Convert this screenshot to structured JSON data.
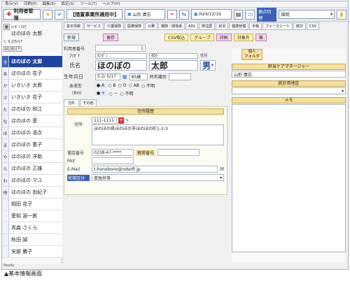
{
  "menu": [
    "表示(V)",
    "印刷(P)",
    "編集(E)",
    "設定(S)",
    "ツール(T)",
    "ヘルプ(H)"
  ],
  "toolbar": {
    "title": "利用者管理",
    "mode": "【措置事業所適用中】",
    "user": "山形 廣志",
    "date": "H24/12/19",
    "office_label": "拠点切替",
    "office_value": "福岡"
  },
  "tabs": [
    "基本情報",
    "サービス",
    "介護保険",
    "医療保険",
    "公費",
    "親族・関係者",
    "ADL",
    "既往歴",
    "状況",
    "健康管理",
    "手帳",
    "フェースシート",
    "統計",
    "CSV"
  ],
  "actions": {
    "new": "新規",
    "save": "保存",
    "csv": "CSV取込",
    "group": "グループ",
    "print": "印刷",
    "target": "対象外",
    "cancel": "無"
  },
  "left": {
    "header_kana": "ﾎﾉﾎﾞﾉ ﾀﾛｳ",
    "header_name": "ほのぼの 太郎",
    "header_date": "S 2/5/17",
    "kana_col": [
      "全",
      "あ",
      "か",
      "さ",
      "た",
      "な",
      "は",
      "ま",
      "や",
      "ら",
      "わ",
      "他"
    ],
    "names": [
      "ほのぼの 太郎",
      "ほのぼの 花子",
      "いきいき 太郎",
      "いきいき 花子",
      "ほのぼの 和江",
      "ほのぼの 愛",
      "ほのぼの 浩次",
      "ほのぼの 重子",
      "ほのぼの 洋助",
      "ほのぼの 正雄",
      "ほのぼの マユ",
      "ほのぼの 由紀子",
      "相田 花子",
      "愛知 源一郎",
      "青森 さくら",
      "秋田 誠",
      "安部 勝子"
    ]
  },
  "form": {
    "user_no_label": "利用者番号",
    "user_no": "1",
    "kana_label": "ﾌﾘｶﾞﾅ",
    "kana_sei": "ﾎﾉﾎﾞﾉ",
    "kana_mei": "ﾀﾛｳ",
    "name_label": "氏名",
    "name_sei": "ほのぼの",
    "name_mei": "太郎",
    "sex_label": "性別",
    "sex": "男",
    "birth_label": "生年月日",
    "birth": "S 2/ 5/17",
    "age": "85歳",
    "same_name_label": "同名識別",
    "blood_label": "血液型",
    "blood_options": [
      "A",
      "B",
      "O",
      "AB",
      "不明"
    ],
    "rh_label": "(RH)",
    "rh_options": [
      "+",
      "－",
      "不明"
    ]
  },
  "subtabs": [
    "住所",
    "その他"
  ],
  "address": {
    "head": "住所履歴",
    "label": "住所",
    "zip": "111-1111",
    "line": "ほのぼの県ほのぼの市ほのぼの町1-2-3",
    "tel_label": "電話番号",
    "tel": "0238-47-****",
    "mobile_label": "携帯番号",
    "fax_label": "FAX",
    "email_label": "E-Mail",
    "email": "t-honobono@ndsoft.jp",
    "household_label": "世帯区分",
    "household": "単独世帯"
  },
  "right": {
    "folder": "個人\nフォルダ",
    "manager_label": "担当ケアマネージャー",
    "manager": "山形 廣志",
    "stats_label": "統計用地区",
    "memo_label": "メモ"
  },
  "status": "Ready",
  "caption": "▲基本情報画面"
}
